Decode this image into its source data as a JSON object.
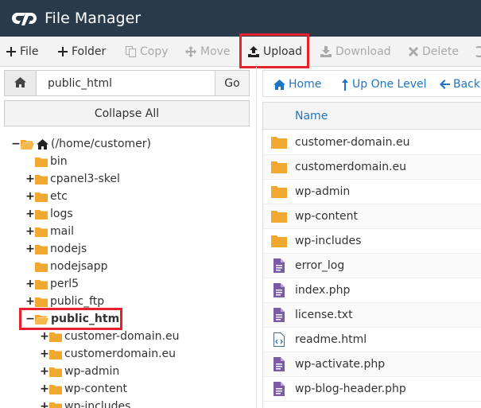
{
  "header": {
    "title": "File Manager"
  },
  "toolbar": {
    "file": "File",
    "folder": "Folder",
    "copy": "Copy",
    "move": "Move",
    "upload": "Upload",
    "download": "Download",
    "delete": "Delete"
  },
  "path": {
    "value": "public_html",
    "go": "Go"
  },
  "collapse_all": "Collapse All",
  "tree": {
    "root": "(/home/customer)",
    "items": [
      "bin",
      "cpanel3-skel",
      "etc",
      "logs",
      "mail",
      "nodejs",
      "nodejsapp",
      "perl5",
      "public_ftp",
      "public_html"
    ],
    "children": [
      "customer-domain.eu",
      "customerdomain.eu",
      "wp-admin",
      "wp-content",
      "wp-includes"
    ]
  },
  "nav": {
    "home": "Home",
    "up": "Up One Level",
    "back": "Back"
  },
  "table": {
    "col_name": "Name",
    "rows": [
      {
        "name": "customer-domain.eu",
        "type": "folder"
      },
      {
        "name": "customerdomain.eu",
        "type": "folder"
      },
      {
        "name": "wp-admin",
        "type": "folder"
      },
      {
        "name": "wp-content",
        "type": "folder"
      },
      {
        "name": "wp-includes",
        "type": "folder"
      },
      {
        "name": "error_log",
        "type": "text"
      },
      {
        "name": "index.php",
        "type": "text"
      },
      {
        "name": "license.txt",
        "type": "text"
      },
      {
        "name": "readme.html",
        "type": "html"
      },
      {
        "name": "wp-activate.php",
        "type": "text"
      },
      {
        "name": "wp-blog-header.php",
        "type": "text"
      }
    ]
  },
  "colors": {
    "header_bg": "#293a4a",
    "link": "#1f75c2",
    "folder": "#f0a830",
    "file": "#7b5aa6",
    "highlight": "#e8222c"
  }
}
